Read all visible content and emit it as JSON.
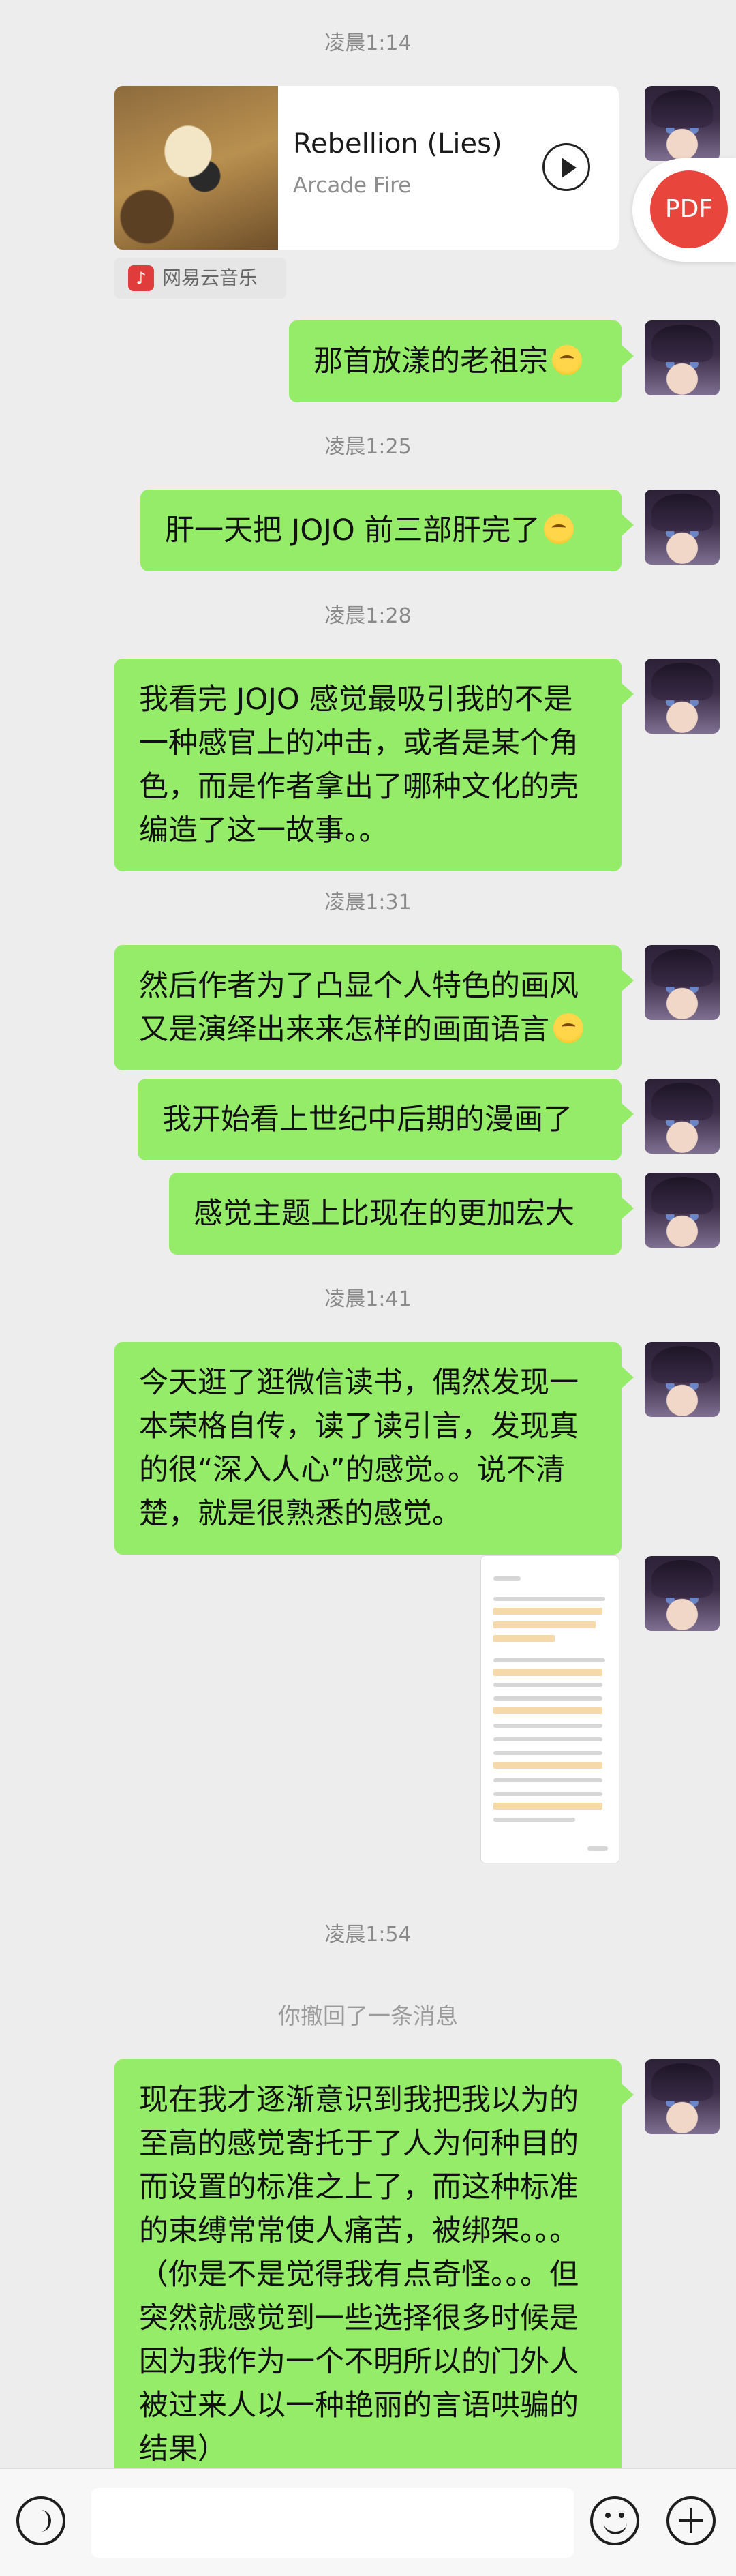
{
  "timestamps": [
    "凌晨1:14",
    "凌晨1:25",
    "凌晨1:28",
    "凌晨1:31",
    "凌晨1:41",
    "凌晨1:54"
  ],
  "music_card": {
    "title": "Rebellion (Lies)",
    "artist": "Arcade Fire",
    "source": "网易云音乐",
    "source_icon": "netease-music-icon"
  },
  "pdf_button": {
    "label": "PDF",
    "color": "#e8453d"
  },
  "messages": [
    {
      "text": "那首放漾的老祖宗",
      "emoji": "smiling-face"
    },
    {
      "text": "肝一天把 JOJO 前三部肝完了",
      "emoji": "halo-face"
    },
    {
      "text": "我看完 JOJO 感觉最吸引我的不是一种感官上的冲击，或者是某个角色，而是作者拿出了哪种文化的壳编造了这一故事。。"
    },
    {
      "text": "然后作者为了凸显个人特色的画风又是演绎出来来怎样的画面语言",
      "emoji": "yum-face"
    },
    {
      "text": "我开始看上世纪中后期的漫画了"
    },
    {
      "text": "感觉主题上比现在的更加宏大"
    },
    {
      "text": "今天逛了逛微信读书，偶然发现一本荣格自传，读了读引言，发现真的很“深入人心”的感觉。。说不清楚，就是很熟悉的感觉。"
    },
    {
      "text": "现在我才逐渐意识到我把我以为的至高的感觉寄托于了人为何种目的而设置的标准之上了，而这种标准的束缚常常使人痛苦，被绑架。。。（你是不是觉得我有点奇怪。。。但突然就感觉到一些选择很多时候是因为我作为一个不明所以的门外人被过来人以一种艳丽的言语哄骗的结果）"
    }
  ],
  "recall_notice": "你撤回了一条消息",
  "colors": {
    "bubble": "#95ec69",
    "background": "#ededed",
    "timestamp": "#8a8a8a"
  },
  "bottom_bar": {
    "voice_icon": "voice-icon",
    "emoji_icon": "emoji-icon",
    "plus_icon": "plus-icon",
    "input_value": ""
  }
}
